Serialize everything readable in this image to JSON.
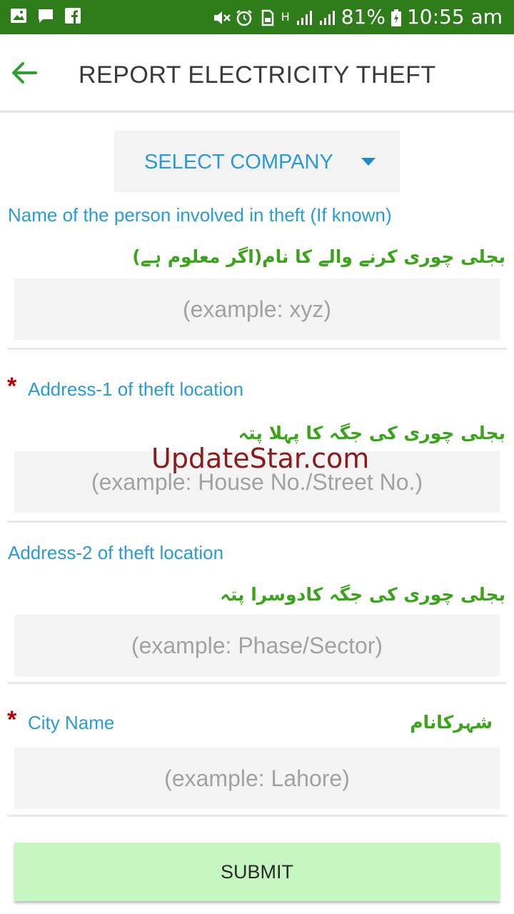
{
  "status_bar": {
    "battery_percent": "81%",
    "time": "10:55 am",
    "network": "H"
  },
  "toolbar": {
    "title": "REPORT ELECTRICITY THEFT"
  },
  "company_select": {
    "label": "SELECT COMPANY"
  },
  "form": {
    "person_name": {
      "label": "Name of the person involved in theft (If known)",
      "urdu": "بجلی چوری کرنے والے کا نام(اگر معلوم ہے)",
      "placeholder": "(example: xyz)"
    },
    "address1": {
      "required": "*",
      "label": "Address-1 of theft location",
      "urdu": "بجلی چوری کی جگہ کا پہلا پتہ",
      "placeholder": "(example: House No./Street No.)"
    },
    "address2": {
      "label": "Address-2 of theft location",
      "urdu": "بجلی چوری کی جگہ کادوسرا پتہ",
      "placeholder": "(example: Phase/Sector)"
    },
    "city": {
      "required": "*",
      "label": "City Name",
      "urdu": "شہرکانام",
      "placeholder": "(example: Lahore)"
    }
  },
  "watermark": "UpdateStar.com",
  "submit_label": "SUBMIT",
  "colors": {
    "status_bar": "#2f7d1a",
    "label_blue": "#2b9bd6",
    "urdu_green": "#3aa41a",
    "required_red": "#c00000",
    "submit_bg": "#c6f7c1"
  }
}
